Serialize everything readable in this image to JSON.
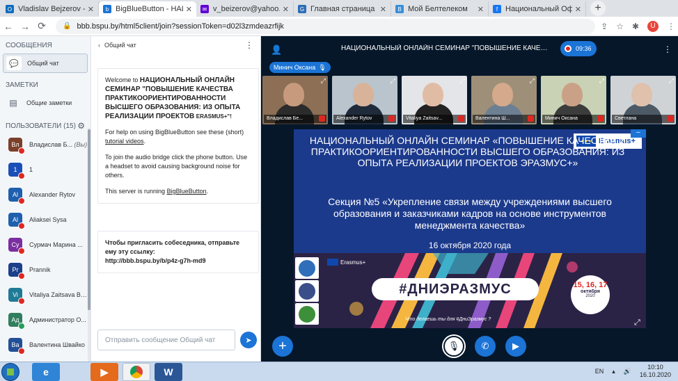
{
  "browser": {
    "tabs": [
      {
        "title": "Vladislav Bejzerov - Outl",
        "color": "#0f6cbd",
        "glyph": "O"
      },
      {
        "title": "BigBlueButton - НАЦ",
        "color": "#1b74d6",
        "glyph": "b"
      },
      {
        "title": "v_beizerov@yahoo.com",
        "color": "#6001d2",
        "glyph": "✉"
      },
      {
        "title": "Главная страница | Гомель",
        "color": "#2d6db5",
        "glyph": "G"
      },
      {
        "title": "Мой Белтелеком",
        "color": "#3a8ed8",
        "glyph": "B"
      },
      {
        "title": "Национальный Офис Эр",
        "color": "#1877f2",
        "glyph": "f"
      }
    ],
    "url": "bbb.bspu.by/html5client/join?sessionToken=d02l3zmdeazrfijk",
    "profile_initial": "U"
  },
  "userlist": {
    "messages_title": "СООБЩЕНИЯ",
    "chat_item": "Общий чат",
    "notes_title": "ЗАМЕТКИ",
    "notes_item": "Общие заметки",
    "users_title": "ПОЛЬЗОВАТЕЛИ",
    "users_count": "(15)",
    "users": [
      {
        "initials": "Вл",
        "name": "Владислав Б...",
        "suffix": "(Вы)",
        "color": "#7b3f2a",
        "mic": "muted"
      },
      {
        "initials": "1",
        "name": "1",
        "suffix": "",
        "color": "#1b4fb8",
        "mic": "muted"
      },
      {
        "initials": "Al",
        "name": "Alexander Rytov",
        "suffix": "",
        "color": "#1f5fae",
        "mic": "muted"
      },
      {
        "initials": "Al",
        "name": "Aliaksei Sysa",
        "suffix": "",
        "color": "#1f5fae",
        "mic": "muted"
      },
      {
        "initials": "Су",
        "name": "Сурмач Марина ...",
        "suffix": "",
        "color": "#7a2ea0",
        "mic": "muted"
      },
      {
        "initials": "Pr",
        "name": "Prannik",
        "suffix": "",
        "color": "#1b3f8a",
        "mic": "muted"
      },
      {
        "initials": "Vi",
        "name": "Vitaliya Zaitsava BSU",
        "suffix": "",
        "color": "#1f7a96",
        "mic": "muted"
      },
      {
        "initials": "Ад",
        "name": "Администратор О...",
        "suffix": "",
        "color": "#2f7e5e",
        "mic": "on"
      },
      {
        "initials": "Ва",
        "name": "Валентина Швайко",
        "suffix": "",
        "color": "#234f96",
        "mic": "muted"
      }
    ]
  },
  "chat": {
    "title": "Общий чат",
    "welcome_prefix": "Welcome to",
    "welcome_name": "НАЦИОНАЛЬНЫЙ ОНЛАЙН СЕМИНАР \"ПОВЫШЕНИЕ КАЧЕСТВА ПРАКТИКООРИЕНТИРОВАННОСТИ ВЫСШЕГО ОБРАЗОВАНИЯ: ИЗ ОПЫТА РЕАЛИЗАЦИИ ПРОЕКТОВ",
    "welcome_tail": "ERASMUS+\"!",
    "help_prefix": "For help on using BigBlueButton see these (short)",
    "help_link": "tutorial videos",
    "help_suffix": ".",
    "audio_text": "To join the audio bridge click the phone button. Use a headset to avoid causing background noise for others.",
    "server_prefix": "This server is running",
    "server_link": "BigBlueButton",
    "server_suffix": ".",
    "invite_text": "Чтобы пригласить собеседника, отправьте ему эту ссылку:",
    "invite_link": "http://bbb.bspu.by/b/p4z-g7h-md9",
    "input_placeholder": "Отправить сообщение Общий чат"
  },
  "meeting": {
    "title": "НАЦИОНАЛЬНЫЙ ОНЛАЙН СЕМИНАР \"ПОВЫШЕНИЕ КАЧЕСТ...",
    "timer": "09:36",
    "talking": "Минич Оксана",
    "videos": [
      {
        "name": "Владислав Бе...",
        "bg": "#8c6f55",
        "skin": "#c79a7e",
        "cloth": "#2b2b2b"
      },
      {
        "name": "Alexander Rytov",
        "bg": "#b9c4cc",
        "skin": "#d8b39a",
        "cloth": "#1f2a3a"
      },
      {
        "name": "Vitaliya Zaitsav...",
        "bg": "#e3e5e8",
        "skin": "#e1bca5",
        "cloth": "#222222"
      },
      {
        "name": "Валентина Ш...",
        "bg": "#9e8f78",
        "skin": "#d4a98c",
        "cloth": "#6d7f93"
      },
      {
        "name": "Минич Оксана",
        "bg": "#c9d2b4",
        "skin": "#caa186",
        "cloth": "#3c3c3c"
      },
      {
        "name": "Светлана",
        "bg": "#cfd3d6",
        "skin": "#dfc1ac",
        "cloth": "#4d5a66"
      }
    ]
  },
  "slide": {
    "heading": "НАЦИОНАЛЬНЫЙ ОНЛАЙН СЕМИНАР «ПОВЫШЕНИЕ КАЧЕСТВА И ПРАКТИКООРИЕНТИРОВАННОСТИ ВЫСШЕГО ОБРАЗОВАНИЯ: ИЗ ОПЫТА РЕАЛИЗАЦИИ ПРОЕКТОВ ЭРАЗМУС+»",
    "section": "Секция №5 «Укрепление связи между учреждениями высшего образования и заказчиками кадров на основе инструментов менеджмента качества»",
    "date": "16 октября 2020 года",
    "logo_text": "Erasmus+",
    "banner_erasmus": "Erasmus+",
    "hashtag": "#ДНИЭРАЗМУС",
    "tagline": "Что делаешь ты для #ДниЭразмус ?",
    "badge_days": "15, 16, 17",
    "badge_month": "октября",
    "badge_year": "2020"
  },
  "taskbar": {
    "lang": "EN",
    "time": "10:10",
    "date": "16.10.2020"
  }
}
